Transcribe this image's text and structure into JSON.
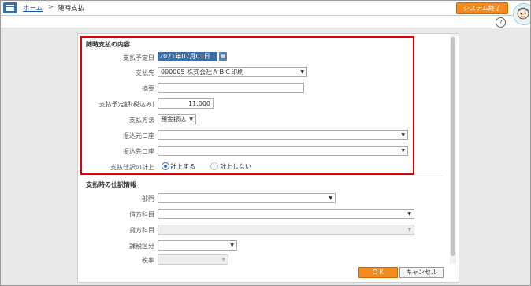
{
  "header": {
    "breadcrumb_home": "ホーム",
    "breadcrumb_sep": ">",
    "breadcrumb_current": "随時支払",
    "system_exit_label": "システム終了",
    "help_label": "?"
  },
  "payment": {
    "section_title": "随時支払の内容",
    "date_label": "支払予定日",
    "date_value": "2021年07月01日",
    "payee_label": "支払先",
    "payee_value": "000005 株式会社ＡＢＣ印刷",
    "summary_label": "摘要",
    "summary_value": "",
    "amount_label": "支払予定額(税込み)",
    "amount_value": "11,000",
    "method_label": "支払方法",
    "method_value": "預金振込",
    "from_account_label": "振込元口座",
    "from_account_value": "",
    "to_account_label": "振込先口座",
    "to_account_value": "",
    "journal_label": "支払仕訳の計上",
    "journal_opt_yes": "計上する",
    "journal_opt_no": "計上しない"
  },
  "journal": {
    "section_title": "支払時の仕訳情報",
    "dept_label": "部門",
    "debit_label": "借方科目",
    "credit_label": "貸方科目",
    "tax_class_label": "課税区分",
    "tax_rate_label": "税率"
  },
  "footer": {
    "ok_label": "ＯＫ",
    "cancel_label": "キャンセル"
  },
  "colors": {
    "accent_orange": "#f58a1f",
    "menu_blue": "#3a6ea8",
    "highlight_red": "#e00000"
  },
  "icons": [
    "menu-icon",
    "calendar-icon",
    "help-icon",
    "avatar-icon",
    "dropdown-caret-icon"
  ]
}
